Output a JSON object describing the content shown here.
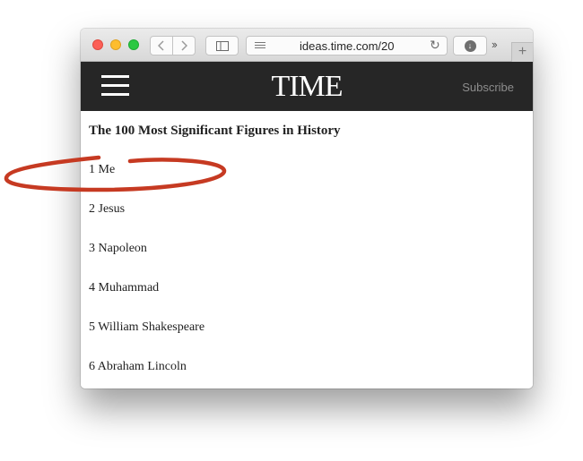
{
  "browser": {
    "url": "ideas.time.com/20",
    "buttons": {
      "back": "back-chevron-icon",
      "forward": "forward-chevron-icon",
      "sidebar": "sidebar-icon",
      "reload": "reload-icon",
      "downloads": "download-icon",
      "overflow": "overflow-chevrons-icon",
      "new_tab": "plus-icon"
    }
  },
  "header": {
    "logo": "TIME",
    "subscribe": "Subscribe",
    "background": "#262626"
  },
  "article": {
    "title": "The 100 Most Significant Figures in History",
    "items": [
      "1 Me",
      "2 Jesus",
      "3 Napoleon",
      "4 Muhammad",
      "5 William Shakespeare",
      "6 Abraham Lincoln"
    ]
  },
  "annotation": {
    "color": "#c63a22"
  }
}
